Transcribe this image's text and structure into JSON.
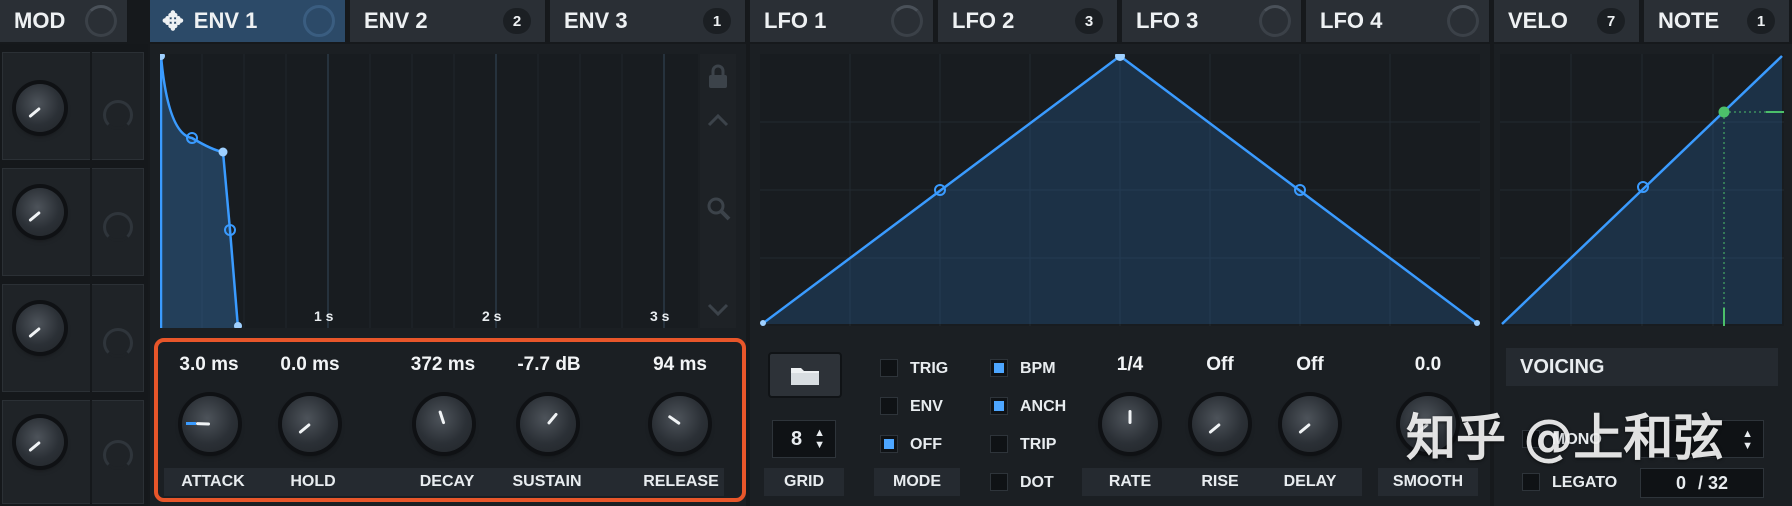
{
  "tabs": {
    "mod": {
      "label": "MOD"
    },
    "env1": {
      "label": "ENV 1"
    },
    "env2": {
      "label": "ENV 2",
      "badge": "2"
    },
    "env3": {
      "label": "ENV 3",
      "badge": "1"
    },
    "lfo1": {
      "label": "LFO 1"
    },
    "lfo2": {
      "label": "LFO 2",
      "badge": "3"
    },
    "lfo3": {
      "label": "LFO 3"
    },
    "lfo4": {
      "label": "LFO 4"
    },
    "velo": {
      "label": "VELO",
      "badge": "7"
    },
    "note": {
      "label": "NOTE",
      "badge": "1"
    }
  },
  "env": {
    "time_markers": [
      "1 s",
      "2 s",
      "3 s"
    ],
    "attack": {
      "value": "3.0 ms",
      "label": "ATTACK"
    },
    "hold": {
      "value": "0.0 ms",
      "label": "HOLD"
    },
    "decay": {
      "value": "372 ms",
      "label": "DECAY"
    },
    "sustain": {
      "value": "-7.7 dB",
      "label": "SUSTAIN"
    },
    "release": {
      "value": "94 ms",
      "label": "RELEASE"
    }
  },
  "lfo": {
    "grid": {
      "value": "8",
      "label": "GRID"
    },
    "mode": {
      "label": "MODE",
      "options": [
        {
          "label": "TRIG",
          "checked": false
        },
        {
          "label": "ENV",
          "checked": false
        },
        {
          "label": "OFF",
          "checked": true
        }
      ]
    },
    "flags": [
      {
        "label": "BPM",
        "checked": true
      },
      {
        "label": "ANCH",
        "checked": true
      },
      {
        "label": "TRIP",
        "checked": false
      },
      {
        "label": "DOT",
        "checked": false
      }
    ],
    "rate": {
      "value": "1/4",
      "label": "RATE"
    },
    "rise": {
      "value": "Off",
      "label": "RISE"
    },
    "delay": {
      "value": "Off",
      "label": "DELAY"
    },
    "smooth": {
      "value": "0.0",
      "label": "SMOOTH"
    }
  },
  "voicing": {
    "title": "VOICING",
    "mono": {
      "label": "MONO"
    },
    "legato": {
      "label": "LEGATO"
    },
    "voices": {
      "current": "0",
      "max": "/ 32"
    }
  },
  "watermark": "知乎 @上和弦",
  "colors": {
    "accent": "#3a9bff",
    "highlight_box": "#e8562a",
    "active_tab": "#2c4a68",
    "velocity_point": "#4cbf6a"
  }
}
